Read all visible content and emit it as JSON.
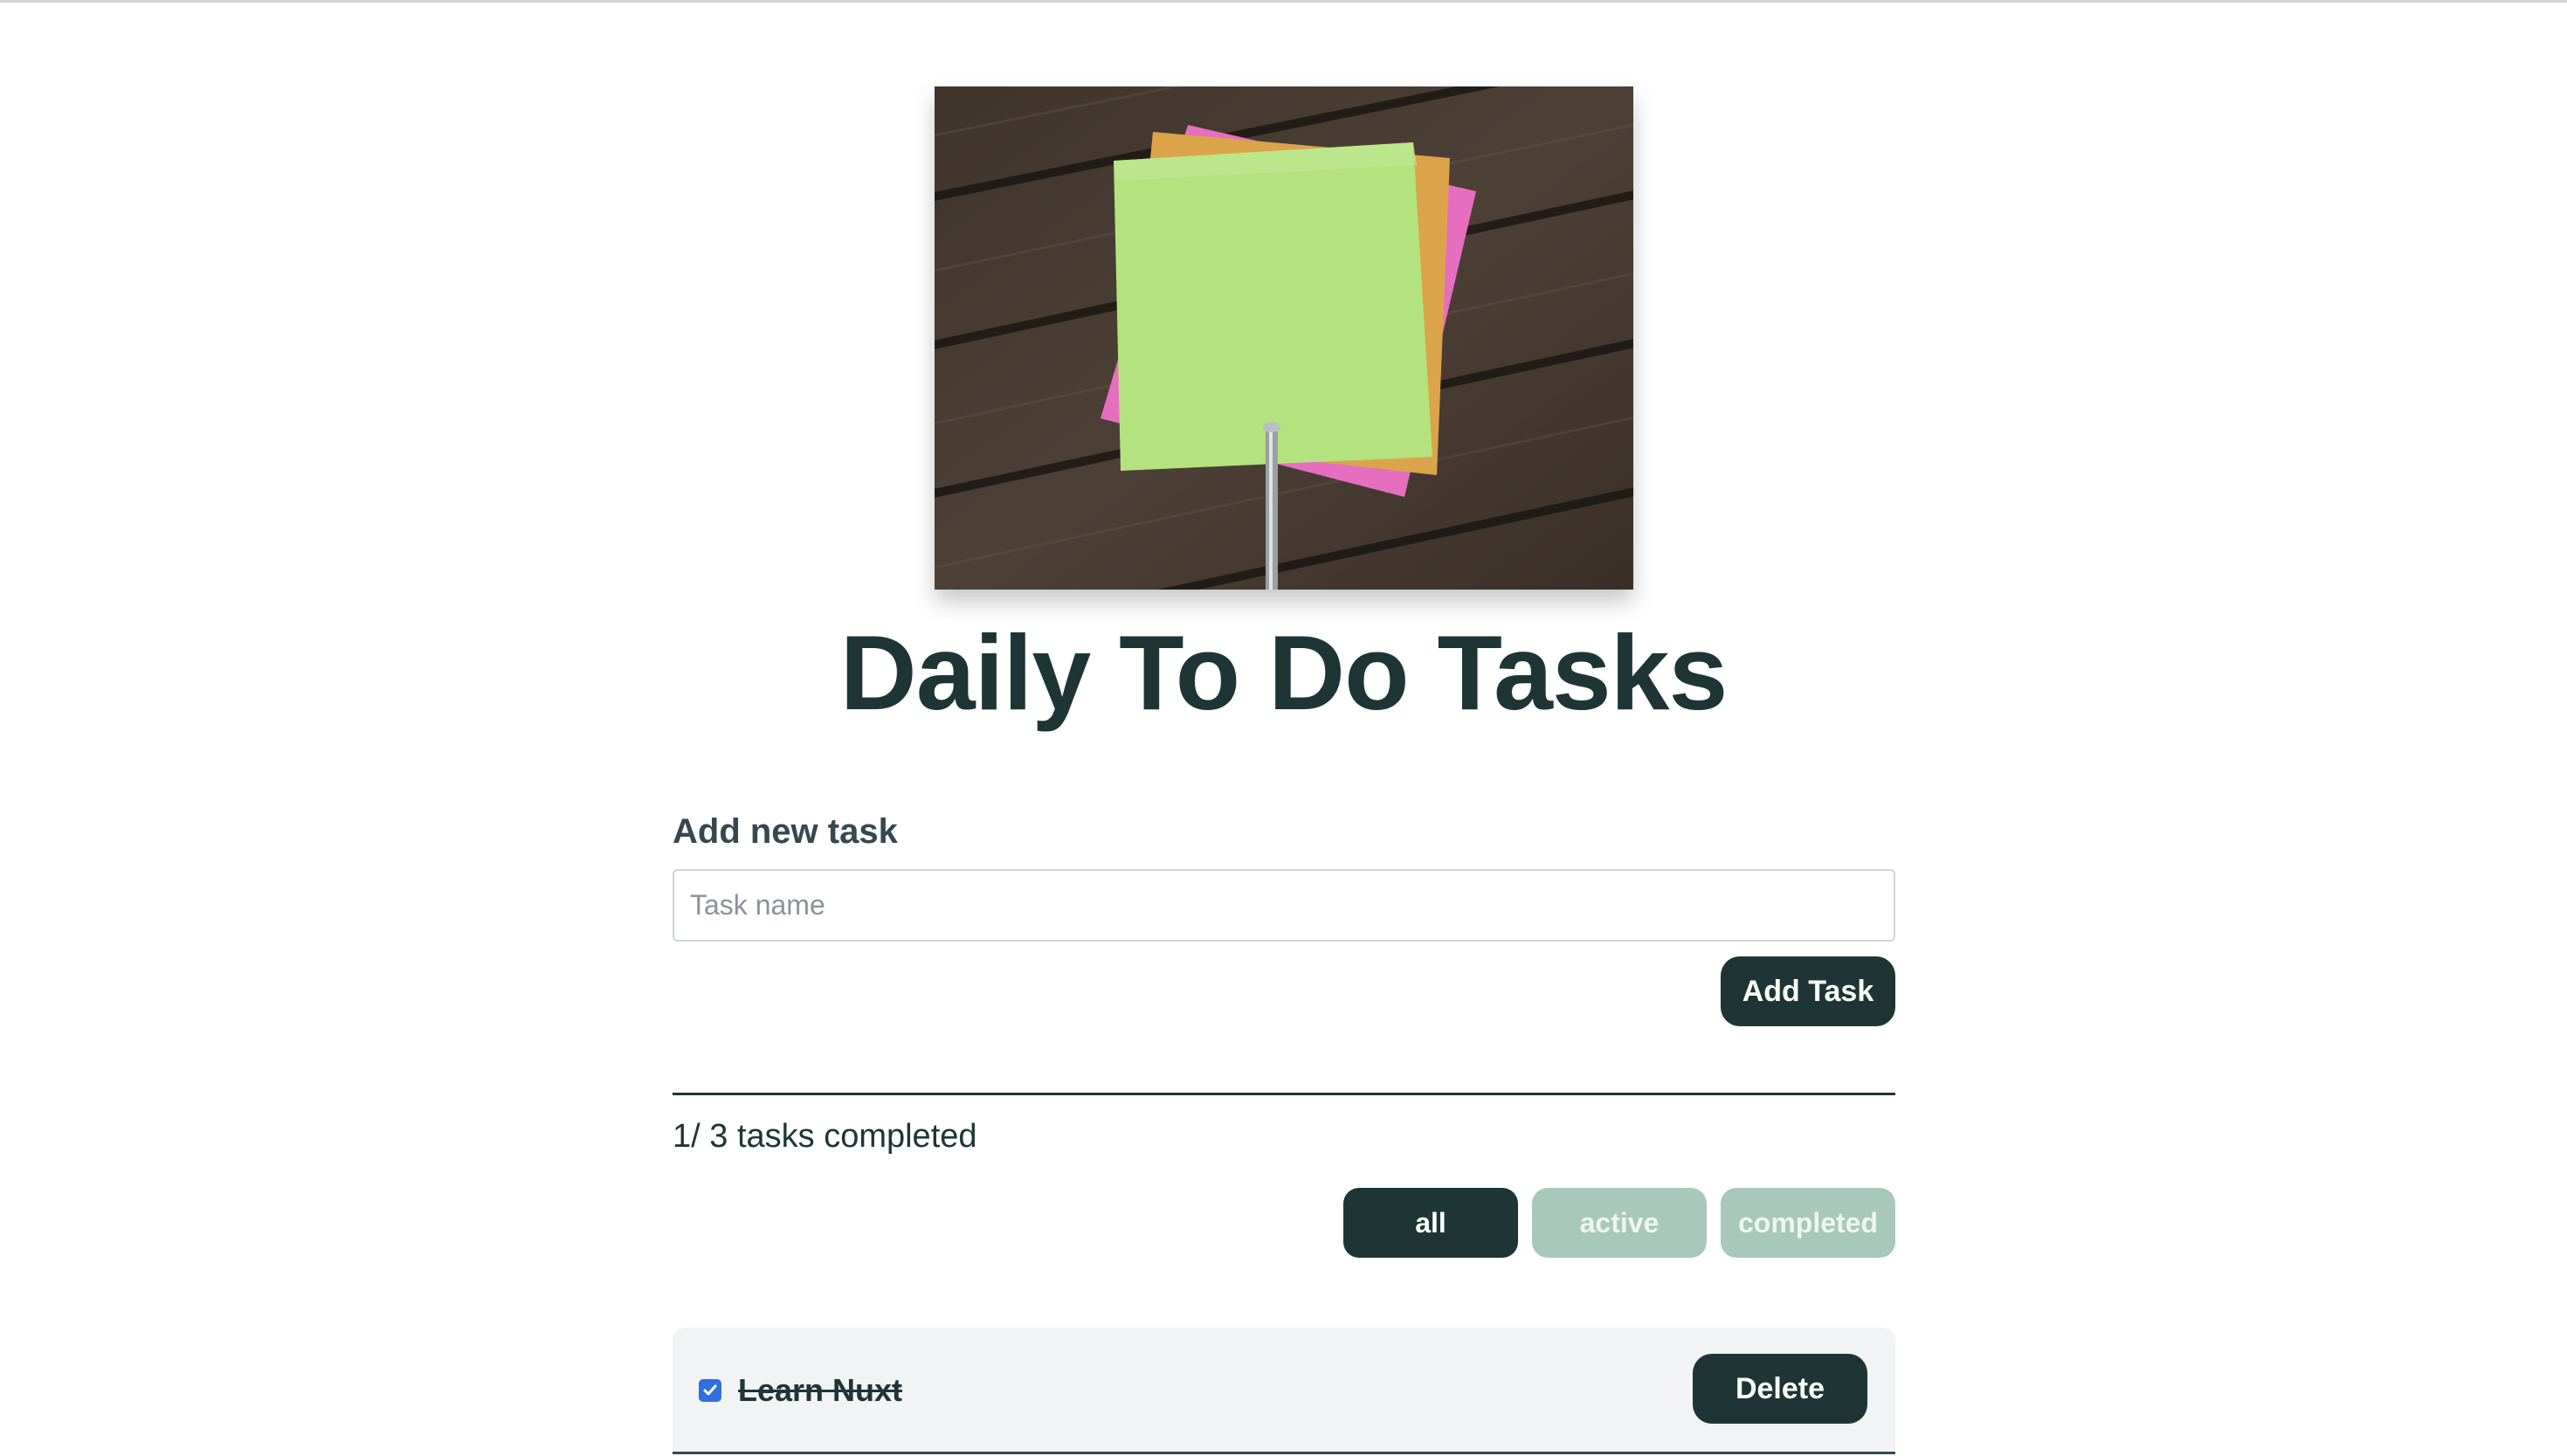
{
  "hero_image": {
    "alt": "",
    "icon": "sticky-notes-photo"
  },
  "page": {
    "title": "Daily To Do Tasks"
  },
  "add_form": {
    "label": "Add new task",
    "input_placeholder": "Task name",
    "input_value": "",
    "add_button_label": "Add Task"
  },
  "status": {
    "text": "1/ 3 tasks completed"
  },
  "filters": {
    "all": "all",
    "active": "active",
    "completed": "completed",
    "selected": "all"
  },
  "tasks": [
    {
      "name": "Learn Nuxt",
      "completed": true,
      "delete_label": "Delete"
    }
  ],
  "colors": {
    "primary": "#1f3535",
    "filter_inactive": "#a8c8bb",
    "card_bg": "#f2f3f5",
    "checkbox": "#2f6fde"
  }
}
